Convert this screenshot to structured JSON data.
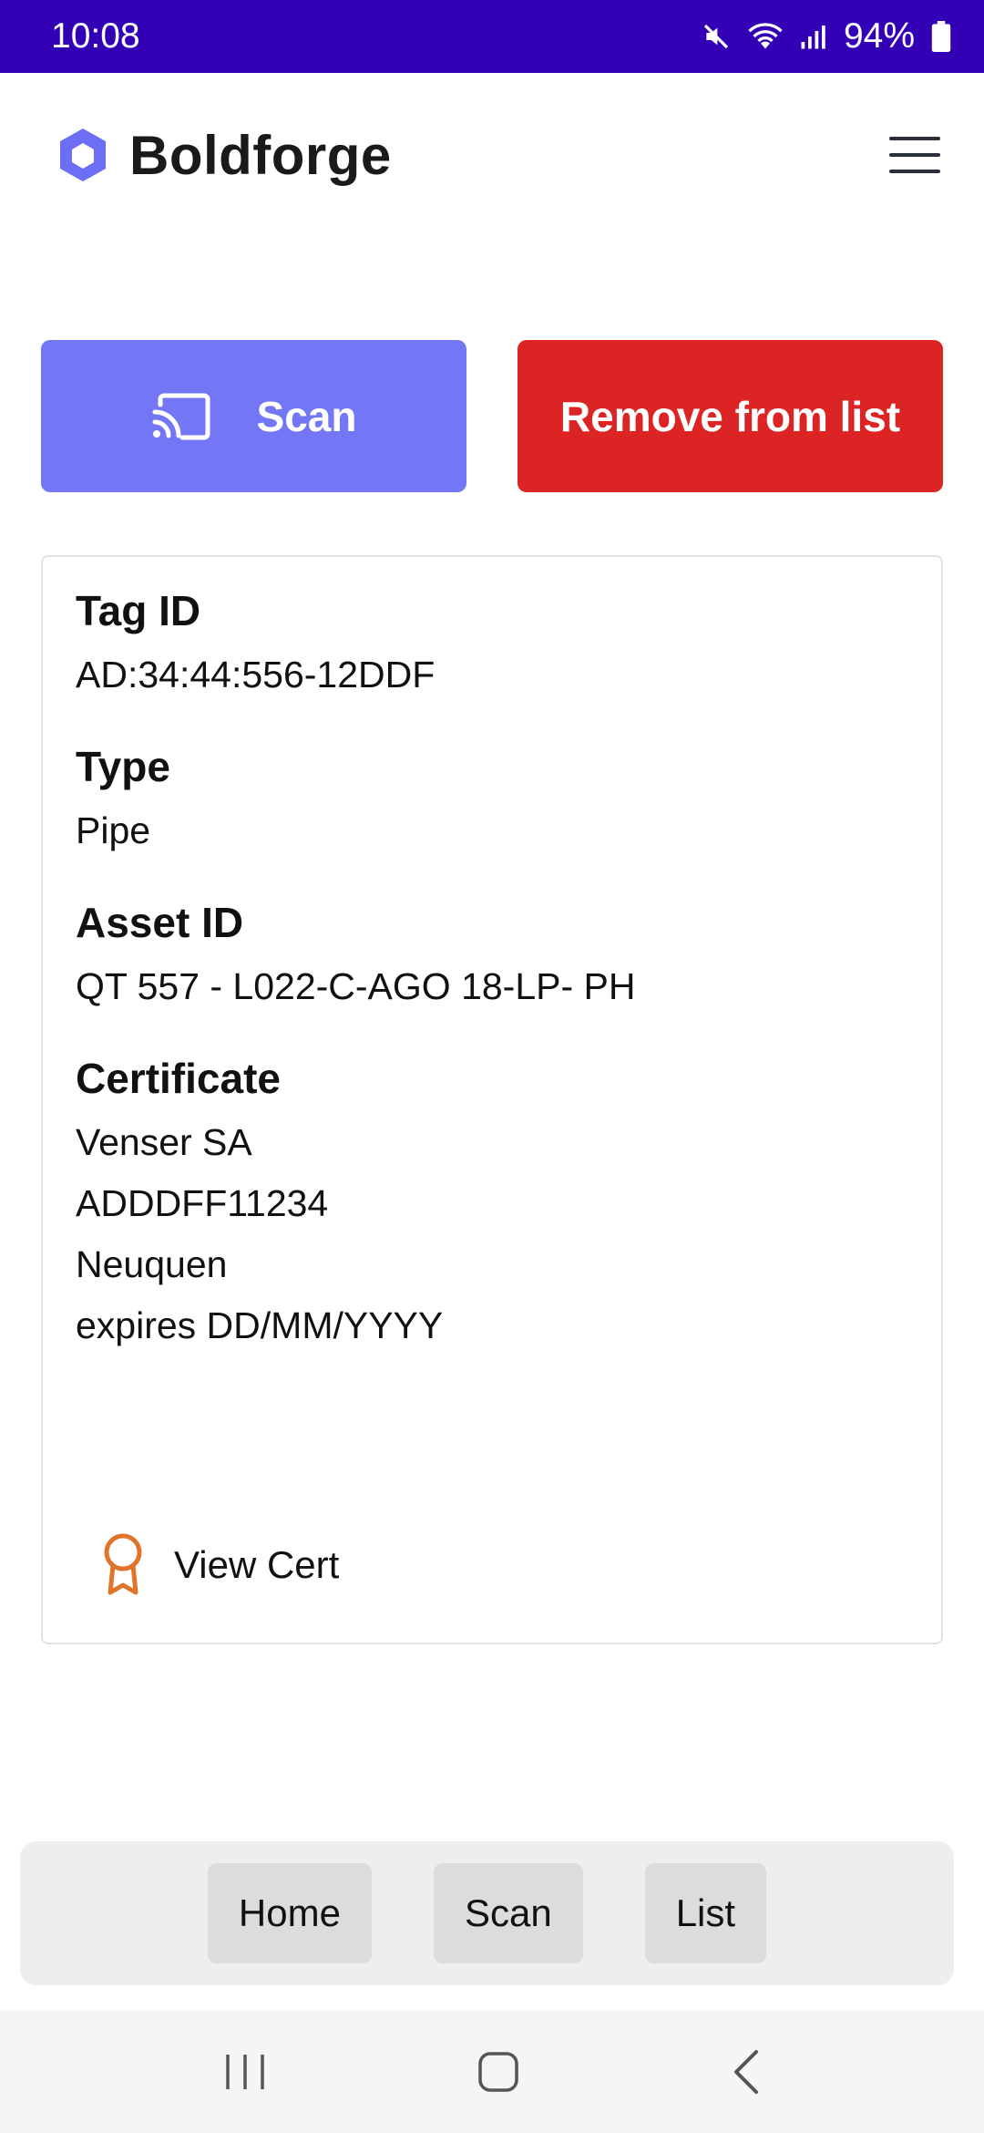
{
  "status_bar": {
    "time": "10:08",
    "battery": "94%",
    "icons": [
      "mute-icon",
      "wifi-icon",
      "signal-icon",
      "battery-icon"
    ]
  },
  "header": {
    "brand": "Boldforge",
    "logo_icon": "hexagon-logo-icon",
    "menu_icon": "hamburger-menu-icon"
  },
  "actions": {
    "scan_label": "Scan",
    "scan_icon": "cast-icon",
    "remove_label": "Remove from list"
  },
  "details": {
    "tag_id_label": "Tag ID",
    "tag_id_value": "AD:34:44:556-12DDF",
    "type_label": "Type",
    "type_value": "Pipe",
    "asset_id_label": "Asset ID",
    "asset_id_value": "QT 557 - L022-C-AGO 18-LP- PH",
    "certificate_label": "Certificate",
    "certificate_lines": [
      "Venser SA",
      "ADDDFF11234",
      "Neuquen",
      "expires DD/MM/YYYY"
    ],
    "view_cert_label": "View Cert",
    "view_cert_icon": "award-ribbon-icon"
  },
  "bottom_nav": {
    "items": [
      {
        "label": "Home"
      },
      {
        "label": "Scan"
      },
      {
        "label": "List"
      }
    ]
  },
  "colors": {
    "status_bar": "#3300b5",
    "scan_button": "#7477f5",
    "remove_button": "#dc2424",
    "logo": "#6c6ef5",
    "cert_icon": "#e0742a"
  }
}
